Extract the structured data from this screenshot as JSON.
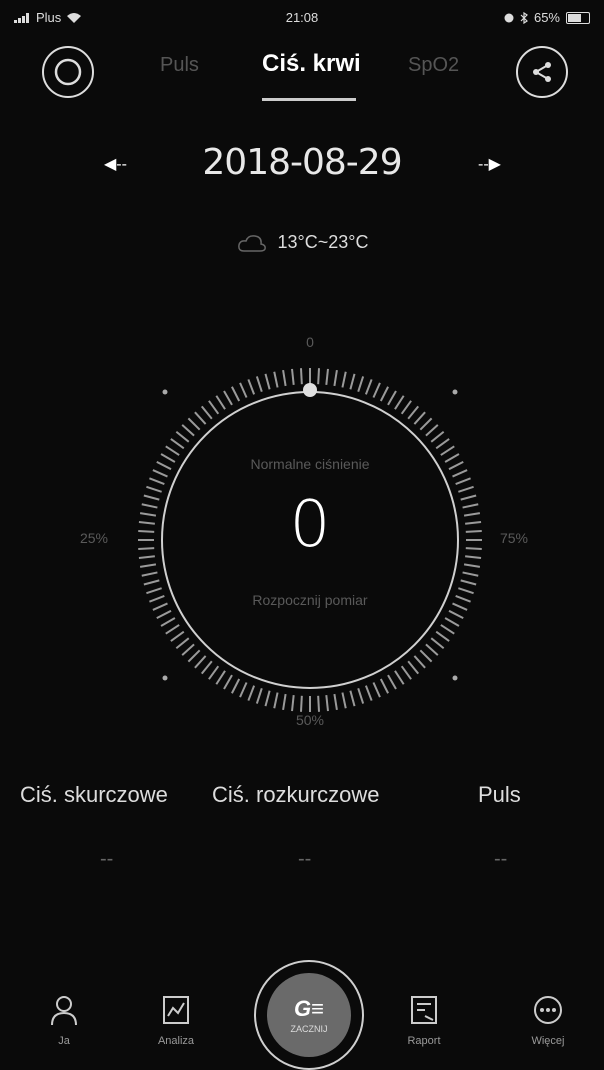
{
  "status_bar": {
    "carrier": "Plus",
    "time": "21:08",
    "battery": "65%"
  },
  "header": {
    "tabs": [
      {
        "label": "Puls",
        "active": false
      },
      {
        "label": "Ciś. krwi",
        "active": true
      },
      {
        "label": "SpO2",
        "active": false
      }
    ],
    "left_icon": "ring-icon",
    "right_icon": "share-icon"
  },
  "date_nav": {
    "date": "2018-08-29",
    "prev_icon": "arrow-left-icon",
    "next_icon": "arrow-right-icon"
  },
  "weather": {
    "icon": "cloud-icon",
    "temperature": "13°C~23°C"
  },
  "gauge": {
    "top_label": "0",
    "left_label": "25%",
    "right_label": "75%",
    "bottom_label": "50%",
    "title": "Normalne ciśnienie",
    "value": "0",
    "subtitle": "Rozpocznij pomiar"
  },
  "metrics": [
    {
      "label": "Ciś. skurczowe",
      "value": "--"
    },
    {
      "label": "Ciś. rozkurczowe",
      "value": "--"
    },
    {
      "label": "Puls",
      "value": "--"
    }
  ],
  "bottom_nav": {
    "items": [
      {
        "label": "Ja",
        "icon": "person-icon"
      },
      {
        "label": "Analiza",
        "icon": "chart-icon"
      },
      {
        "label": "Raport",
        "icon": "report-icon"
      },
      {
        "label": "Więcej",
        "icon": "more-icon"
      }
    ],
    "center": {
      "logo": "G≡",
      "sub": "ZACZNIJ"
    }
  },
  "colors": {
    "background": "#0a0a0a",
    "text": "#ffffff",
    "muted": "#5a5a5a"
  }
}
